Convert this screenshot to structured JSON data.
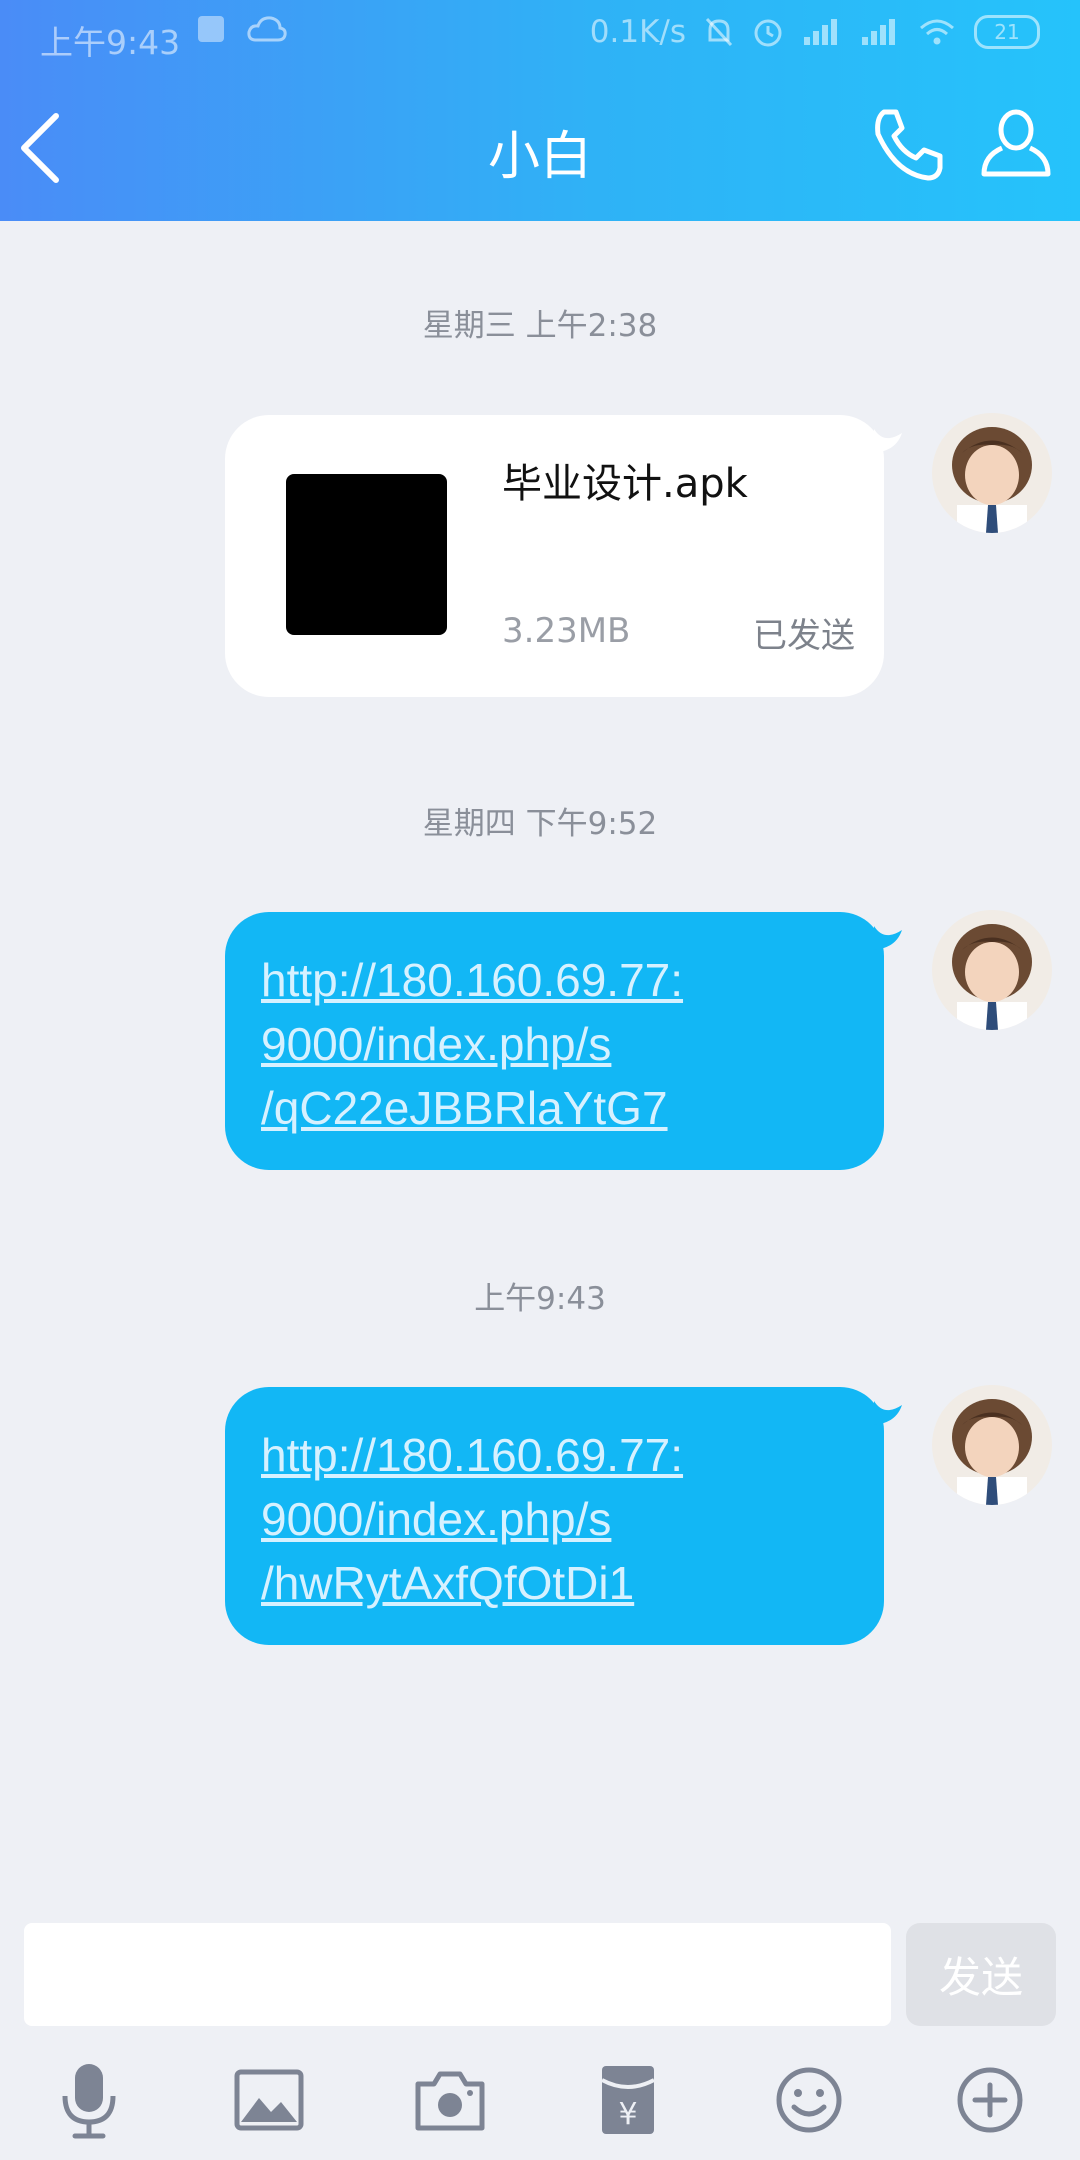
{
  "status_bar": {
    "time": "上午9:43",
    "network_speed": "0.1K/s",
    "battery_level": "21"
  },
  "header": {
    "title": "小白",
    "colors": {
      "gradient_start": "#4a8cf7",
      "gradient_end": "#25c3fb"
    },
    "icons": [
      "back-icon",
      "phone-icon",
      "profile-icon"
    ]
  },
  "messages": [
    {
      "timestamp": "星期三 上午2:38",
      "type": "file",
      "file_name": "毕业设计.apk",
      "file_size": "3.23MB",
      "status": "已发送"
    },
    {
      "timestamp": "星期四 下午9:52",
      "type": "link",
      "text": "http://180.160.69.77:\n9000/index.php/s\n/qC22eJBBRlaYtG7"
    },
    {
      "timestamp": "上午9:43",
      "type": "link",
      "text": "http://180.160.69.77:\n9000/index.php/s\n/hwRytAxfQfOtDi1"
    }
  ],
  "input_bar": {
    "placeholder": "",
    "send_label": "发送"
  },
  "toolbar": {
    "icons": [
      "microphone-icon",
      "image-icon",
      "camera-icon",
      "red-packet-icon",
      "emoji-icon",
      "plus-icon"
    ]
  },
  "colors": {
    "background": "#eef0f5",
    "link_bubble": "#12b7f5",
    "file_bubble": "#ffffff"
  }
}
